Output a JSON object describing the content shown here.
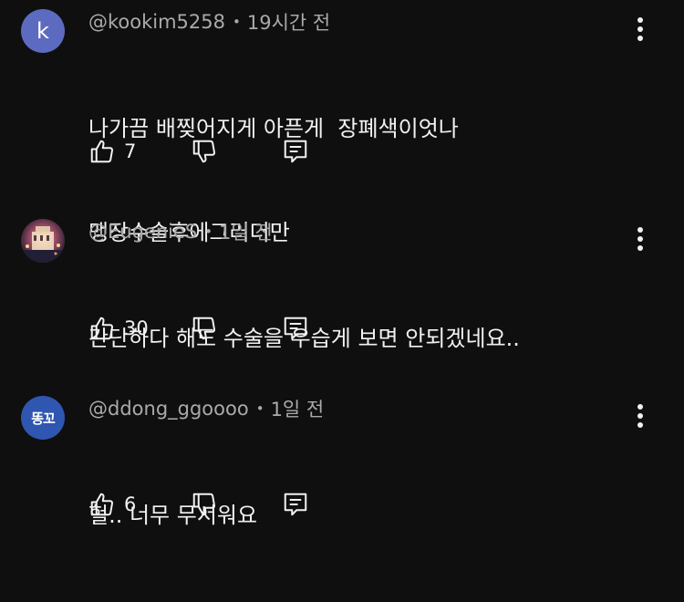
{
  "comments": [
    {
      "avatar": {
        "type": "letter",
        "letter": "k",
        "color": "#5c6bc0"
      },
      "author": "@kookim5258",
      "time": "19시간 전",
      "lines": [
        "나가끔 배찢어지게 아픈게  장폐색이엇나",
        "맹장수술후에그러더만"
      ],
      "likes": "7",
      "icons": {
        "like": "thumbs-up-icon",
        "dislike": "thumbs-down-icon",
        "reply": "reply-icon",
        "more": "more-vert-icon"
      }
    },
    {
      "avatar": {
        "type": "photo",
        "description_icon": "profile-photo"
      },
      "author": "@EugenieS",
      "time": "1일 전",
      "lines": [
        "간단하다 해도 수술을 우습게 보면 안되겠네요.."
      ],
      "likes": "30",
      "icons": {
        "like": "thumbs-up-icon",
        "dislike": "thumbs-down-icon",
        "reply": "reply-icon",
        "more": "more-vert-icon"
      }
    },
    {
      "avatar": {
        "type": "text",
        "text": "똥꼬",
        "color": "#2f56b0"
      },
      "author": "@ddong_ggoooo",
      "time": "1일 전",
      "lines": [
        "헐.. 너무 무서워요"
      ],
      "likes": "6",
      "icons": {
        "like": "thumbs-up-icon",
        "dislike": "thumbs-down-icon",
        "reply": "reply-icon",
        "more": "more-vert-icon"
      }
    }
  ],
  "meta_separator": "•",
  "colors": {
    "background": "#0f0f0f",
    "primary_text": "#f1f1f1",
    "secondary_text": "#aaaaaa"
  }
}
